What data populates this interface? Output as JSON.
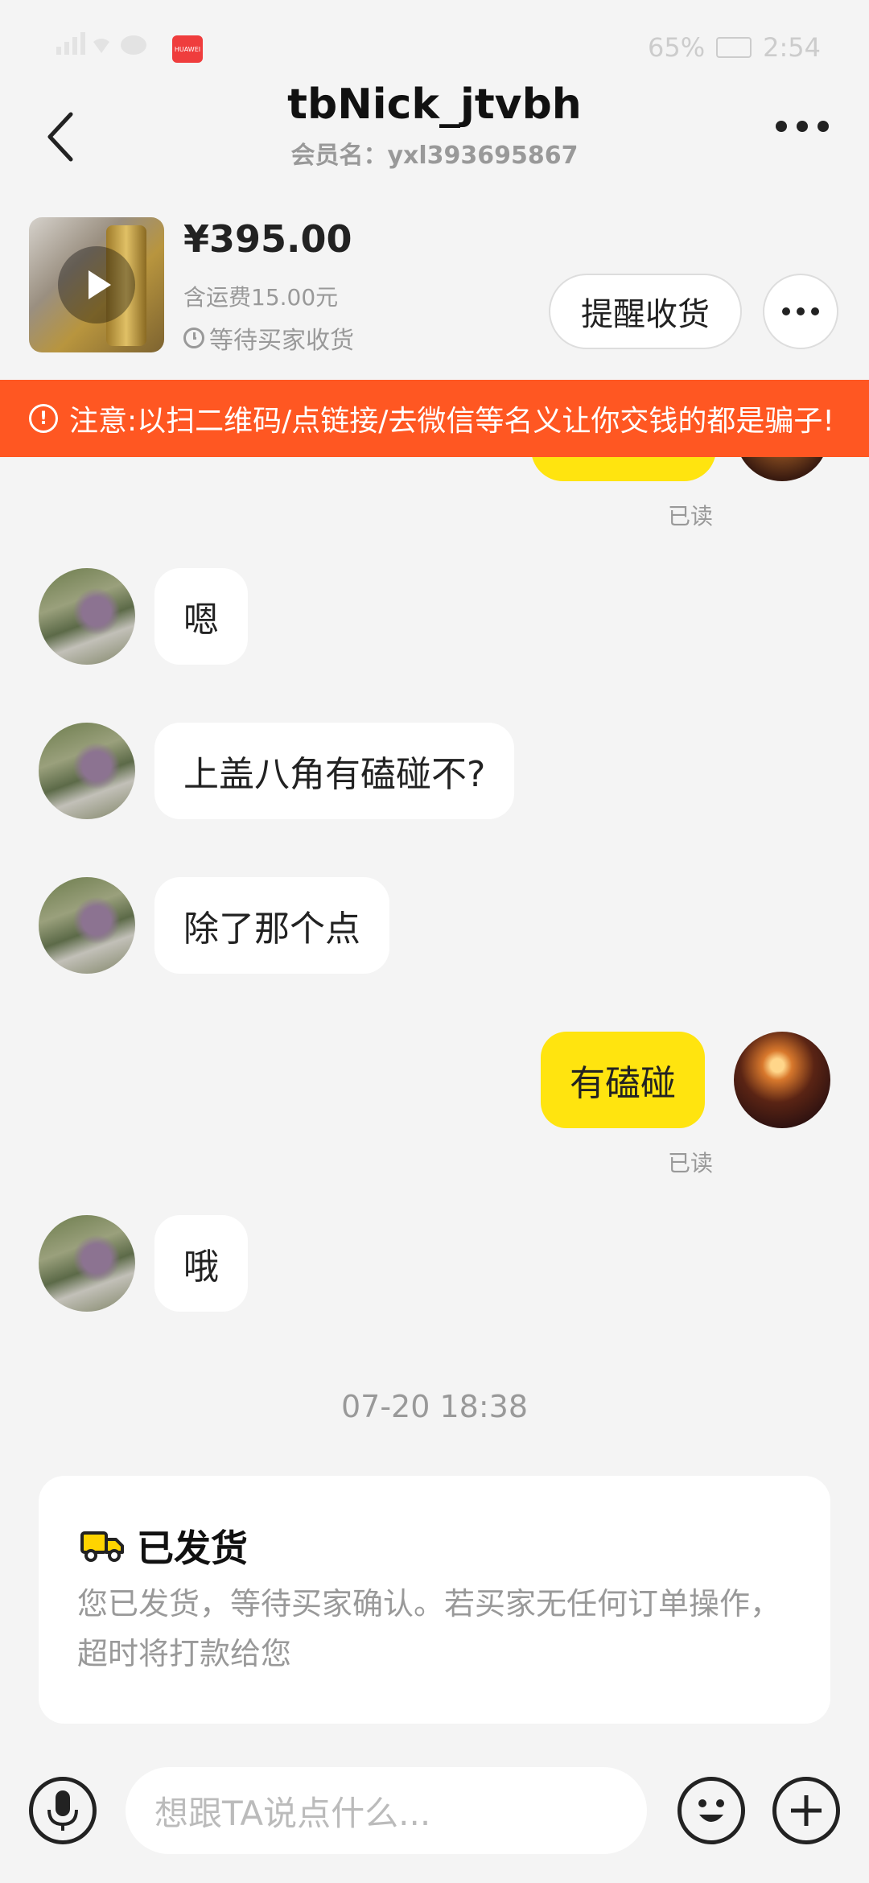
{
  "status_bar": {
    "battery": "65%",
    "time": "2:54"
  },
  "header": {
    "title": "tbNick_jtvbh",
    "subtitle": "会员名：yxl393695867"
  },
  "product": {
    "price": "¥395.00",
    "shipping": "含运费15.00元",
    "status": "等待买家收货",
    "remind_label": "提醒收货"
  },
  "warning": {
    "text": "注意:以扫二维码/点链接/去微信等名义让你交钱的都是骗子!"
  },
  "messages": {
    "read_1": "已读",
    "m1": "嗯",
    "m2": "上盖八角有磕碰不?",
    "m3": "除了那个点",
    "m4": "有磕碰",
    "read_2": "已读",
    "m5": "哦"
  },
  "timestamp": "07-20 18:38",
  "shipping_card": {
    "title": "已发货",
    "desc": "您已发货，等待买家确认。若买家无任何订单操作，超时将打款给您"
  },
  "input": {
    "placeholder": "想跟TA说点什么..."
  },
  "colors": {
    "accent": "#ffe40f",
    "warning": "#ff5722"
  }
}
